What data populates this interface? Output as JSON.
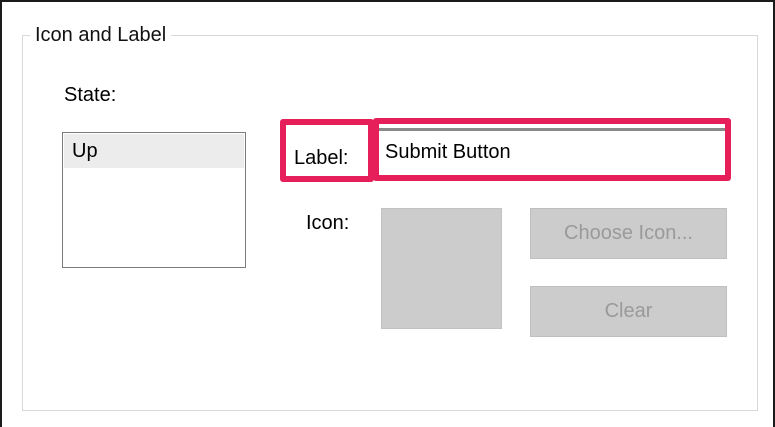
{
  "group": {
    "title": "Icon and Label"
  },
  "state": {
    "label": "State:",
    "items": [
      {
        "label": "Up",
        "selected": true
      }
    ]
  },
  "label_field": {
    "label": "Label:",
    "value": "Submit Button",
    "highlight_color": "#e61e5a"
  },
  "icon_field": {
    "label": "Icon:",
    "choose_button": "Choose Icon...",
    "clear_button": "Clear",
    "buttons_enabled": false
  }
}
